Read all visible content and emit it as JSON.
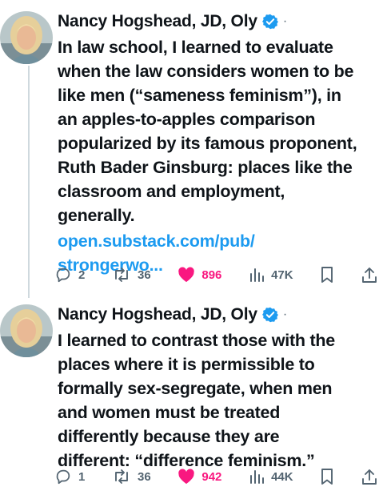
{
  "posts": [
    {
      "author": "Nancy Hogshead, JD, Oly",
      "separator": "·",
      "text": "In law school, I learned to evaluate\nwhen the law considers women to be\nlike men (“sameness feminism”), in\nan apples-to-apples comparison\npopularized by its famous proponent,\nRuth Bader Ginsburg: places like the\nclassroom and employment,\ngenerally.",
      "link": "open.substack.com/pub/\nstrongerwo...",
      "replies": "2",
      "reposts": "36",
      "likes": "896",
      "views": "47K",
      "liked": true
    },
    {
      "author": "Nancy Hogshead, JD, Oly",
      "separator": "·",
      "text": "I learned to contrast those with the\nplaces where it is permissible to\nformally sex-segregate, when men\nand women must be treated\ndifferently because they are\ndifferent: “difference feminism.”",
      "replies": "1",
      "reposts": "36",
      "likes": "942",
      "views": "44K",
      "liked": true
    }
  ],
  "colors": {
    "accent": "#1d9bf0",
    "like": "#f91880",
    "muted": "#536471",
    "thread_line": "#cfd9de"
  },
  "icons": [
    "verified-badge-icon",
    "reply-icon",
    "repost-icon",
    "heart-icon",
    "views-icon",
    "bookmark-icon",
    "share-icon"
  ]
}
